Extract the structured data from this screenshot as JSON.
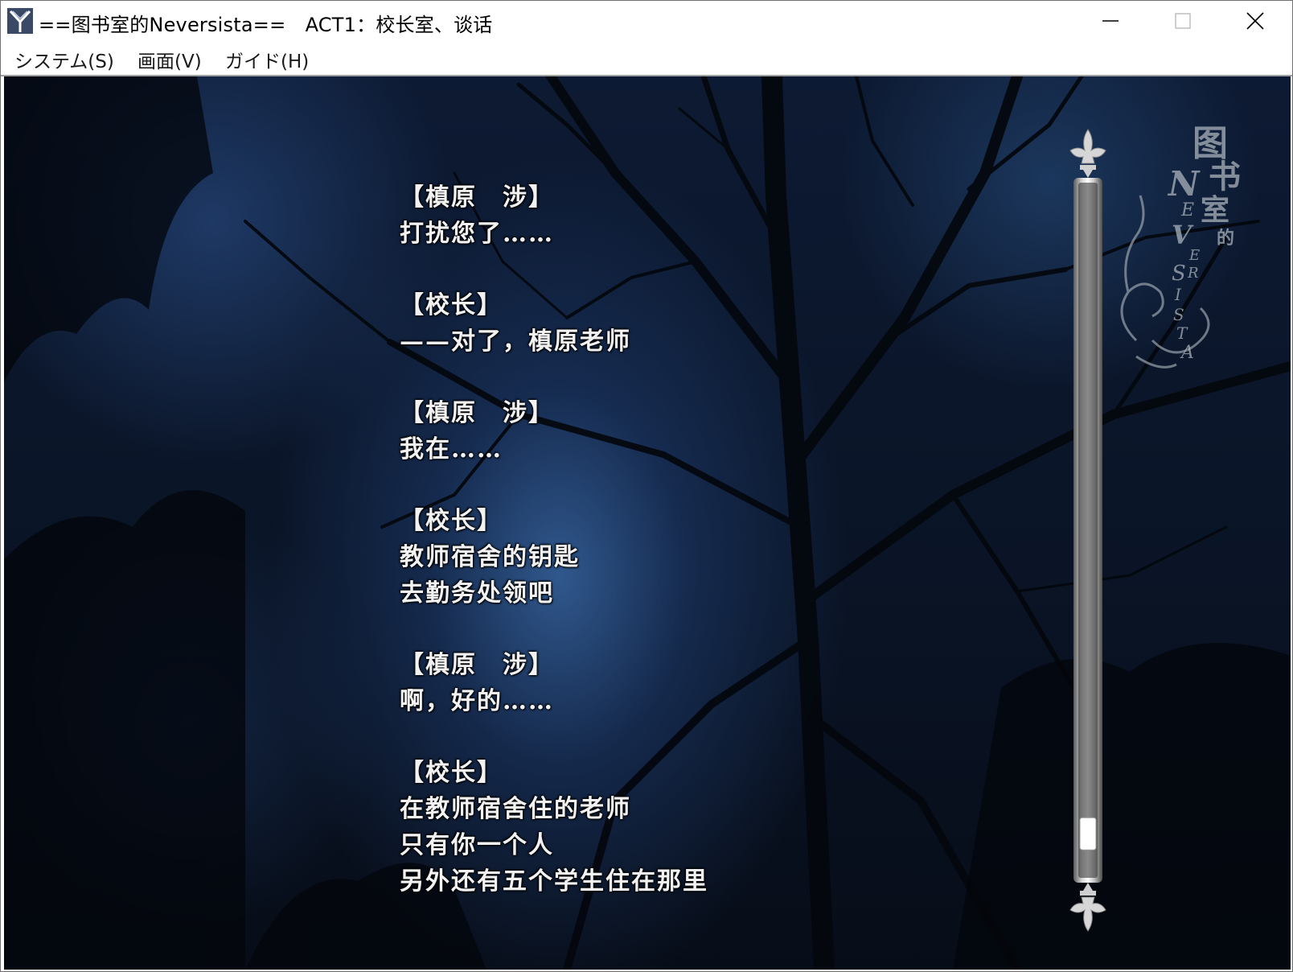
{
  "window": {
    "title": "==图书室的Neversista==　ACT1：校长室、谈话"
  },
  "menu": {
    "items": [
      {
        "label": "システム(S)"
      },
      {
        "label": "画面(V)"
      },
      {
        "label": "ガイド(H)"
      }
    ]
  },
  "dialogue": [
    {
      "speaker": "【槙原　涉】",
      "lines": [
        "打扰您了……"
      ]
    },
    {
      "speaker": "【校长】",
      "lines": [
        "——对了，槙原老师"
      ]
    },
    {
      "speaker": "【槙原　涉】",
      "lines": [
        "我在……"
      ]
    },
    {
      "speaker": "【校长】",
      "lines": [
        "教师宿舍的钥匙",
        "去勤务处领吧"
      ]
    },
    {
      "speaker": "【槙原　涉】",
      "lines": [
        "啊，好的……"
      ]
    },
    {
      "speaker": "【校长】",
      "lines": [
        "在教师宿舍住的老师",
        "只有你一个人",
        "另外还有五个学生住在那里"
      ]
    }
  ],
  "scrollbar": {
    "position": 0.96
  },
  "logo": {
    "text": "图书室的 NEVERSISTA"
  },
  "icons": {
    "app": "y-shaped-app-icon",
    "minimize": "minimize-icon",
    "maximize": "maximize-icon",
    "close": "close-icon"
  }
}
